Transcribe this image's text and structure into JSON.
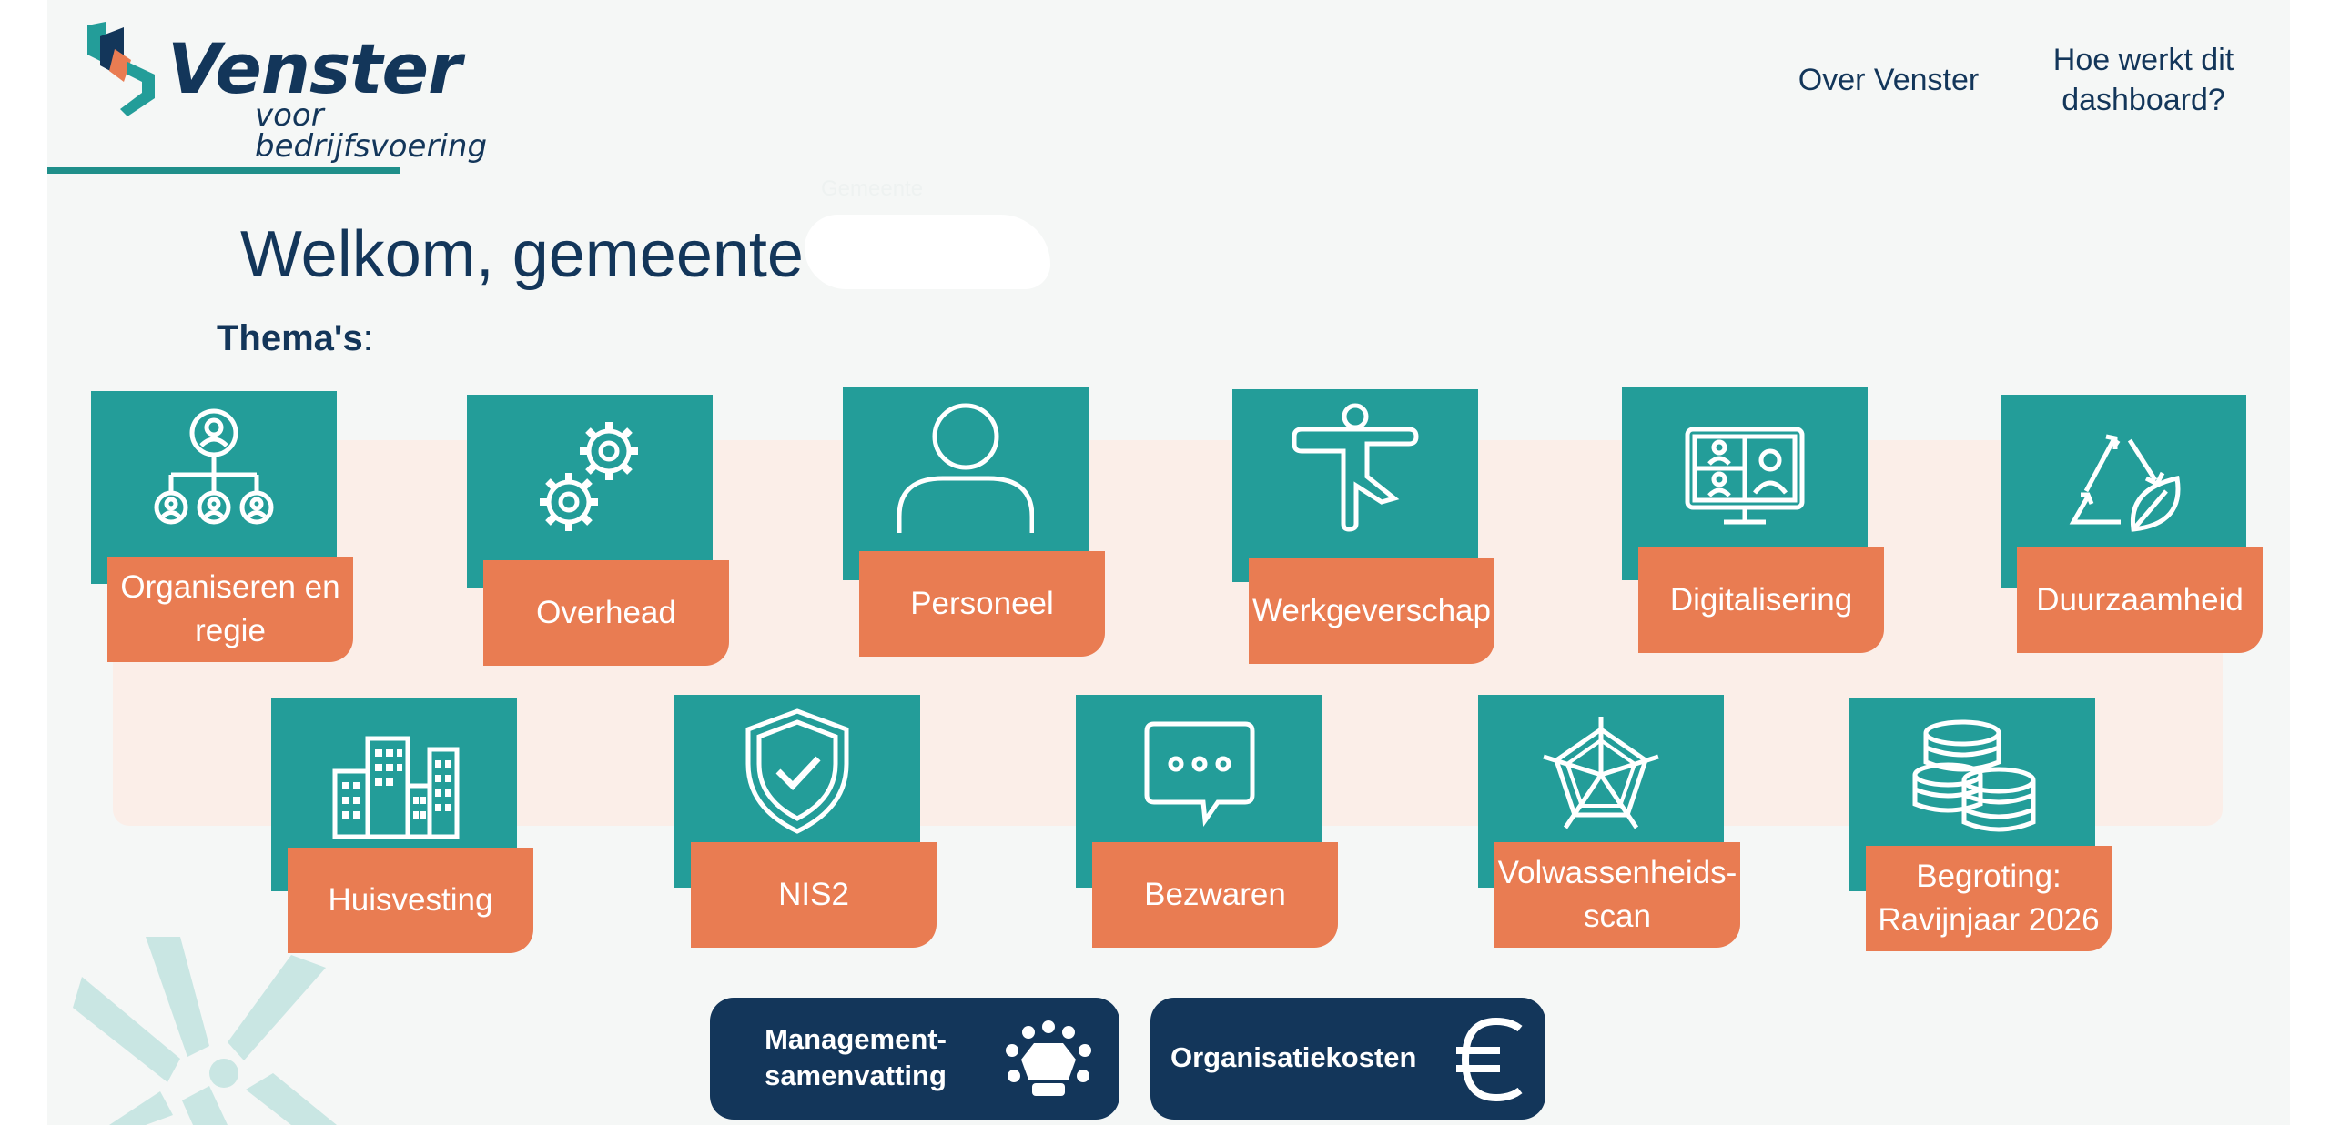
{
  "brand": {
    "name": "Venster",
    "tagline": "voor bedrijfsvoering",
    "colors": {
      "navy": "#13365a",
      "teal": "#239d99",
      "orange": "#e97c52",
      "band": "#fbeee8"
    }
  },
  "nav": {
    "about": "Over Venster",
    "how": "Hoe werkt dit dashboard?"
  },
  "welcome": {
    "greeting": "Welkom, gemeente",
    "ghost_text": "Gemeente"
  },
  "themes": {
    "label": "Thema's",
    "label_colon": ":",
    "items": [
      {
        "label": "Organiseren en regie",
        "icon": "org-chart-icon"
      },
      {
        "label": "Overhead",
        "icon": "gears-icon"
      },
      {
        "label": "Personeel",
        "icon": "person-icon"
      },
      {
        "label": "Werkgeverschap",
        "icon": "yoga-icon"
      },
      {
        "label": "Digitalisering",
        "icon": "video-call-icon"
      },
      {
        "label": "Duurzaamheid",
        "icon": "recycle-leaf-icon"
      },
      {
        "label": "Huisvesting",
        "icon": "buildings-icon"
      },
      {
        "label": "NIS2",
        "icon": "shield-check-icon"
      },
      {
        "label": "Bezwaren",
        "icon": "chat-bubble-icon"
      },
      {
        "label": "Volwassenheids-scan",
        "icon": "radar-chart-icon"
      },
      {
        "label": "Begroting: Ravijnjaar 2026",
        "icon": "coins-icon"
      }
    ]
  },
  "actions": {
    "management": {
      "label": "Management-samenvatting",
      "icon": "meeting-table-icon"
    },
    "costs": {
      "label": "Organisatiekosten",
      "icon": "euro-icon"
    }
  }
}
